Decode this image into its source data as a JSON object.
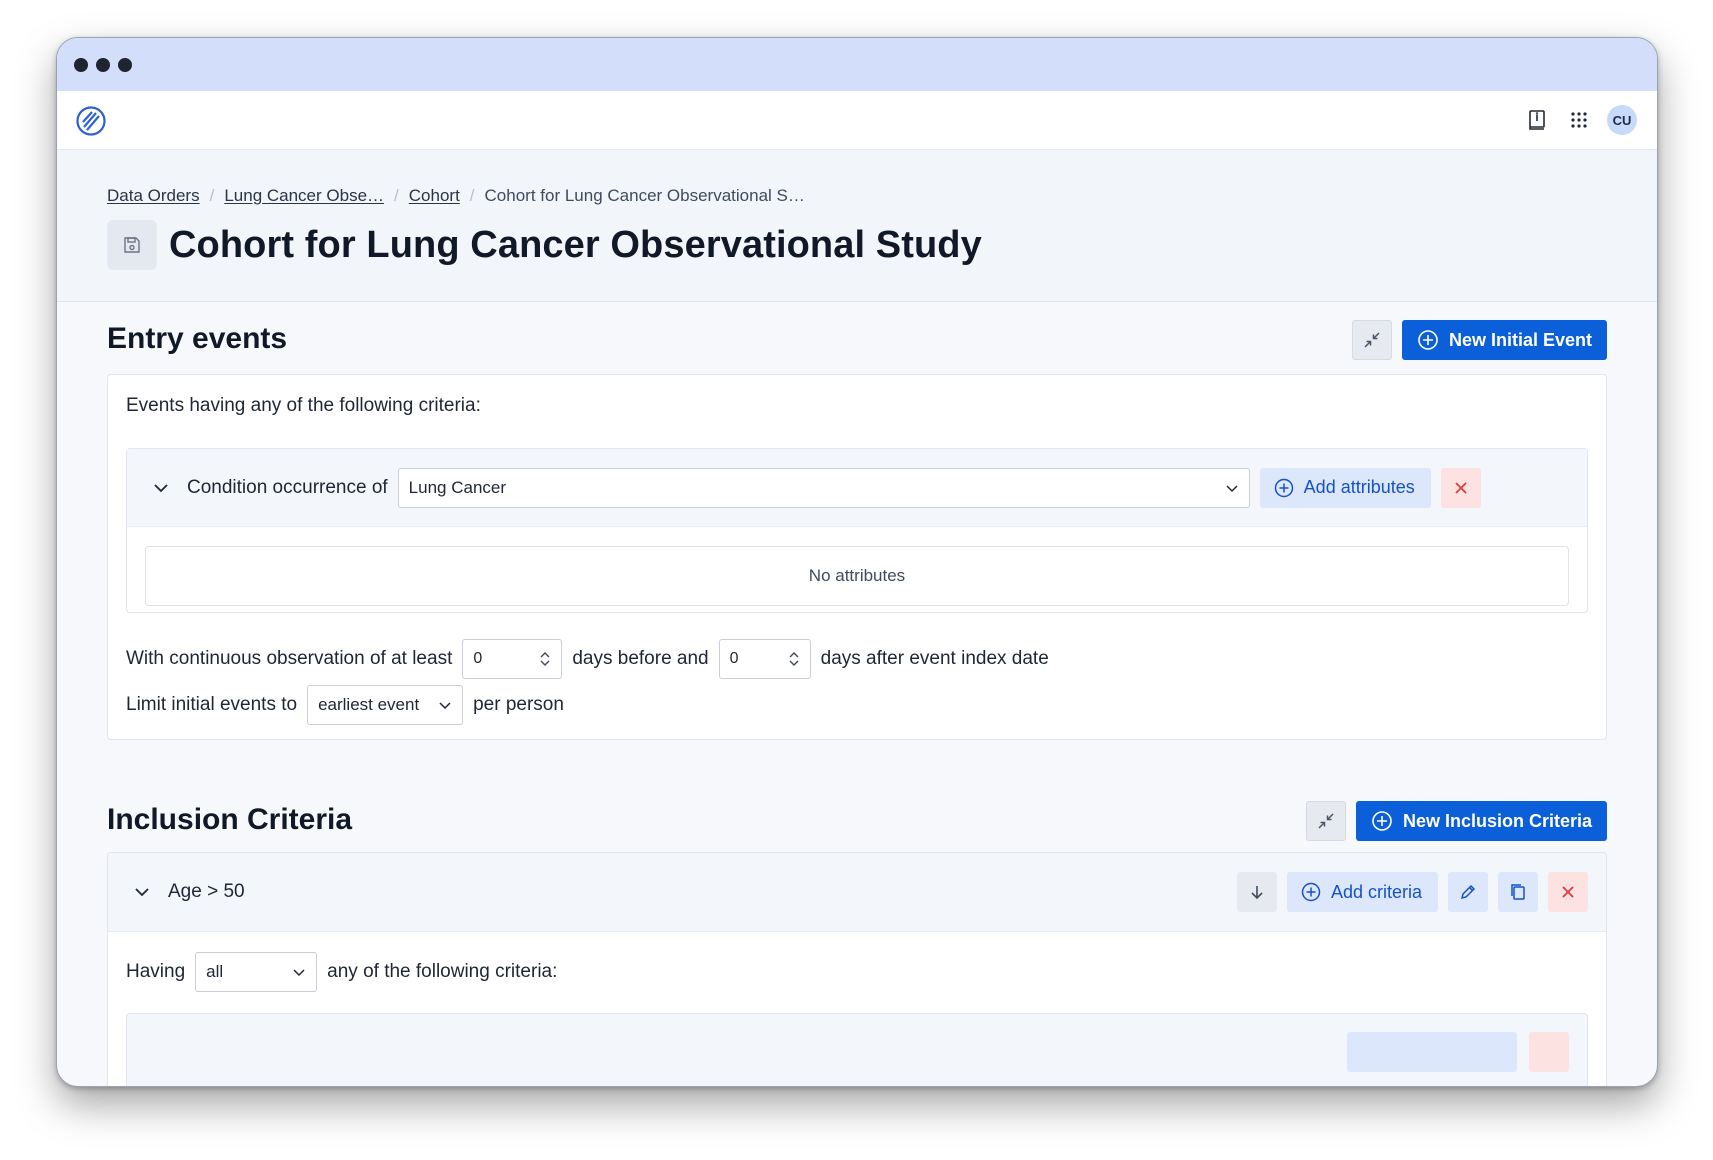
{
  "app": {
    "user_initials": "CU",
    "icons": {
      "logo": "logo-icon",
      "docs": "book-icon",
      "apps": "grid-icon"
    }
  },
  "breadcrumb": {
    "items": [
      "Data Orders",
      "Lung Cancer Obse…",
      "Cohort"
    ],
    "current": "Cohort for Lung Cancer Observational S…"
  },
  "page": {
    "title": "Cohort for Lung Cancer Observational Study"
  },
  "entry_events": {
    "title": "Entry events",
    "new_button": "New Initial Event",
    "intro": "Events having any of the following criteria:",
    "criterion": {
      "label": "Condition occurrence of",
      "value": "Lung Cancer",
      "add_attributes": "Add attributes",
      "empty": "No attributes"
    },
    "observation": {
      "prefix": "With continuous observation of at least",
      "before_value": "0",
      "middle": "days before and",
      "after_value": "0",
      "suffix": "days after event index date"
    },
    "limit": {
      "prefix": "Limit initial events to",
      "value": "earliest event",
      "suffix": "per person"
    }
  },
  "inclusion": {
    "title": "Inclusion Criteria",
    "new_button": "New Inclusion Criteria",
    "rule": {
      "name": "Age > 50",
      "add_criteria": "Add criteria",
      "having_prefix": "Having",
      "having_value": "all",
      "having_suffix": "any of the following criteria:"
    }
  },
  "colors": {
    "accent": "#0b5fd8",
    "soft_accent": "#dce7fb",
    "danger": "#e23b3b",
    "titlebar": "#d3defb"
  }
}
